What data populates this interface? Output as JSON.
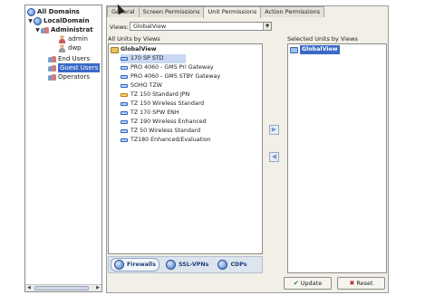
{
  "tree": {
    "items": [
      {
        "label": "All Domains",
        "bold": true,
        "level": 0,
        "icon": "globe-icon",
        "toggle": ""
      },
      {
        "label": "LocalDomain",
        "bold": true,
        "level": 1,
        "icon": "globe-icon",
        "toggle": "▼"
      },
      {
        "label": "Administrat",
        "bold": true,
        "level": 2,
        "icon": "users-icon",
        "toggle": "▼"
      },
      {
        "label": "admin",
        "bold": false,
        "level": 4,
        "icon": "user-icon",
        "toggle": ""
      },
      {
        "label": "dwp",
        "bold": false,
        "level": 4,
        "icon": "user-icon",
        "toggle": ""
      },
      {
        "label": "End Users",
        "bold": false,
        "level": 2,
        "icon": "users-icon",
        "toggle": ""
      },
      {
        "label": "Guest Users",
        "bold": false,
        "level": 2,
        "icon": "users-icon",
        "toggle": "",
        "selected": true
      },
      {
        "label": "Operators",
        "bold": false,
        "level": 2,
        "icon": "users-icon",
        "toggle": ""
      }
    ]
  },
  "tabs": [
    {
      "label": "General",
      "active": false
    },
    {
      "label": "Screen Permissions",
      "active": false
    },
    {
      "label": "Unit Permissions",
      "active": true
    },
    {
      "label": "Action Permissions",
      "active": false
    }
  ],
  "views": {
    "label": "Views:",
    "value": "GlobalView"
  },
  "all_units": {
    "label": "All Units by Views",
    "root": "GlobalView",
    "items": [
      {
        "label": "170 SP STD",
        "color": "blue",
        "highlight": true
      },
      {
        "label": "PRO 4060 - GMS Pri Gateway",
        "color": "blue"
      },
      {
        "label": "PRO 4060 - GMS STBY Gateway",
        "color": "blue"
      },
      {
        "label": "SOHO TZW",
        "color": "blue"
      },
      {
        "label": "TZ 150 Standard JPN",
        "color": "orange"
      },
      {
        "label": "TZ 150 Wireless Standard",
        "color": "blue"
      },
      {
        "label": "TZ 170 SPW ENH",
        "color": "blue"
      },
      {
        "label": "TZ 190 Wireless Enhanced",
        "color": "blue"
      },
      {
        "label": "TZ 50 Wireless Standard",
        "color": "blue"
      },
      {
        "label": "TZ180 Enhanced/Evaluation",
        "color": "blue"
      }
    ]
  },
  "selected_units": {
    "label": "Selected Units by Views",
    "items": [
      {
        "label": "GlobalView"
      }
    ]
  },
  "move_buttons": {
    "right": "▶",
    "left": "◀"
  },
  "type_bar": [
    {
      "label": "Firewalls",
      "active": true
    },
    {
      "label": "SSL-VPNs",
      "active": false
    },
    {
      "label": "CDPs",
      "active": false
    }
  ],
  "buttons": {
    "update": "Update",
    "reset": "Reset"
  }
}
